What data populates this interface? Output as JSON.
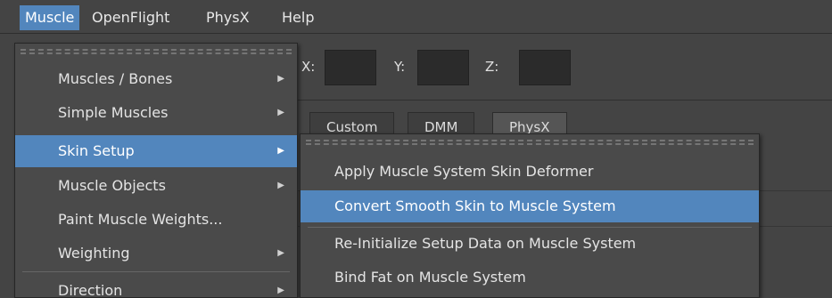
{
  "menubar": {
    "items": [
      {
        "label": "Muscle",
        "active": true
      },
      {
        "label": "OpenFlight",
        "active": false
      },
      {
        "label": "PhysX",
        "active": false
      },
      {
        "label": "Help",
        "active": false
      }
    ]
  },
  "toolbar": {
    "x_label": "X:",
    "y_label": "Y:",
    "z_label": "Z:"
  },
  "tabs": [
    {
      "label": "Custom"
    },
    {
      "label": "DMM"
    },
    {
      "label": "PhysX"
    }
  ],
  "muscle_menu": {
    "items": [
      {
        "label": "Muscles / Bones",
        "submenu": true
      },
      {
        "label": "Simple Muscles",
        "submenu": true
      },
      {
        "label": "Skin Setup",
        "submenu": true,
        "highlighted": true
      },
      {
        "label": "Muscle Objects",
        "submenu": true
      },
      {
        "label": "Paint Muscle Weights...",
        "submenu": false
      },
      {
        "label": "Weighting",
        "submenu": true
      },
      {
        "label": "Direction",
        "submenu": true
      }
    ],
    "arrow_glyph": "▶"
  },
  "skin_setup_menu": {
    "items": [
      {
        "label": "Apply Muscle System Skin Deformer"
      },
      {
        "label": "Convert Smooth Skin to Muscle System",
        "highlighted": true
      },
      {
        "label": "Re-Initialize Setup Data on Muscle System"
      },
      {
        "label": "Bind Fat on Muscle System"
      }
    ]
  },
  "colors": {
    "background": "#444444",
    "highlight": "#5286bd",
    "menu_bg": "#4a4a4a",
    "text": "#e4e4e4"
  }
}
